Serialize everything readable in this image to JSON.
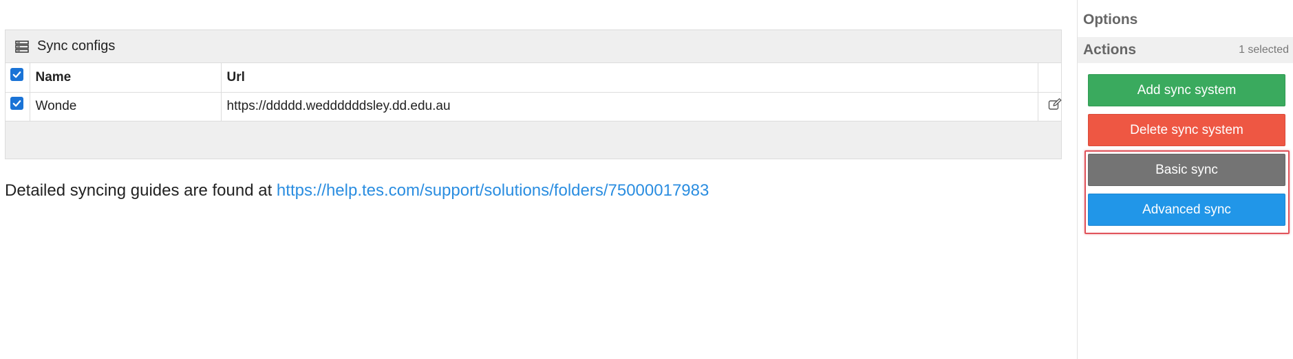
{
  "panel": {
    "title": "Sync configs",
    "columns": {
      "name": "Name",
      "url": "Url"
    },
    "header_checked": true,
    "rows": [
      {
        "checked": true,
        "name": "Wonde",
        "url": "https://ddddd.weddddddsley.dd.edu.au"
      }
    ]
  },
  "guide": {
    "text": "Detailed syncing guides are found at ",
    "link": "https://help.tes.com/support/solutions/folders/75000017983"
  },
  "sidebar": {
    "options_title": "Options",
    "actions_title": "Actions",
    "selected_count": "1 selected",
    "buttons": {
      "add": "Add sync system",
      "delete": "Delete sync system",
      "basic": "Basic sync",
      "advanced": "Advanced sync"
    }
  },
  "colors": {
    "add": "#3aaa5e",
    "delete": "#ee5743",
    "basic": "#747474",
    "advanced": "#2196e8",
    "link": "#2a8de0",
    "checkbox": "#1a73d6",
    "highlight": "#e0525a"
  },
  "icons": {
    "panel_header": "server-icon",
    "row_edit": "edit-icon",
    "checkbox": "checkmark-icon"
  }
}
